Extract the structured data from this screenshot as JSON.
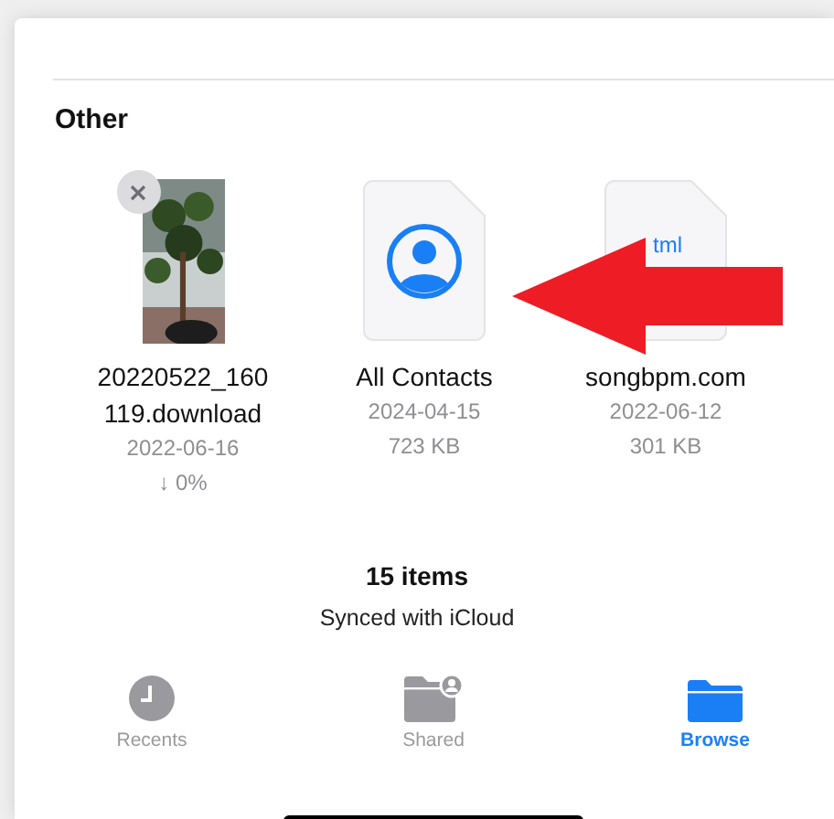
{
  "section": {
    "title": "Other"
  },
  "files": [
    {
      "name": "20220522_160119.download",
      "date": "2022-06-16",
      "status": "↓ 0%",
      "removable": true
    },
    {
      "kind": "contact",
      "name": "All Contacts",
      "date": "2024-04-15",
      "size": "723 KB",
      "removable": false
    },
    {
      "kind": "html",
      "name": "songbpm.com",
      "date": "2022-06-12",
      "size": "301 KB",
      "badge": "tml",
      "removable": false
    }
  ],
  "footer": {
    "count": "15 items",
    "sync": "Synced with iCloud"
  },
  "tabs": [
    {
      "kind": "recents",
      "label": "Recents",
      "selected": false
    },
    {
      "kind": "shared",
      "label": "Shared",
      "selected": false
    },
    {
      "kind": "browse",
      "label": "Browse",
      "selected": true
    }
  ]
}
